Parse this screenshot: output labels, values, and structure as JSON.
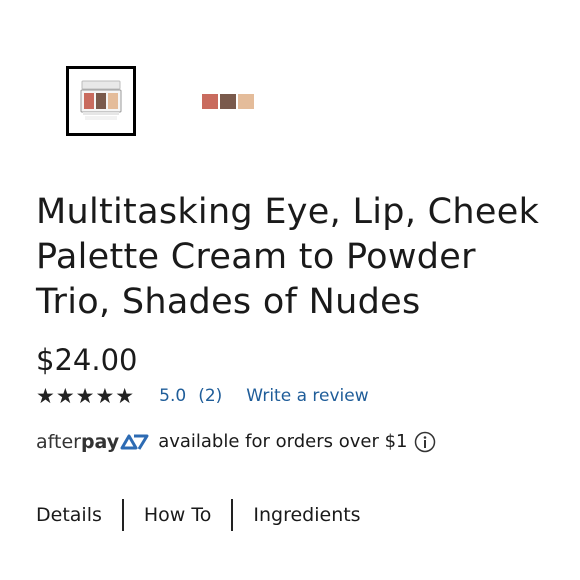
{
  "thumbnails": [
    {
      "name": "palette-open-image",
      "selected": true
    },
    {
      "name": "swatches-image",
      "selected": false
    }
  ],
  "colors": {
    "swatch1": "#c96b5e",
    "swatch2": "#7a5a4c",
    "swatch3": "#e4bc9a",
    "link": "#1f5d99",
    "afterpay_arrow": "#2d6bb3"
  },
  "product": {
    "title": "Multitasking Eye, Lip, Cheek Palette Cream to Powder Trio, Shades of Nudes",
    "price": "$24.00"
  },
  "rating": {
    "stars": "★★★★★",
    "value": "5.0",
    "count": "(2)",
    "write_review": "Write a review"
  },
  "afterpay": {
    "logo_after": "after",
    "logo_pay": "pay",
    "text": "available for orders over $1",
    "info_icon": "info-icon"
  },
  "tabs": [
    {
      "label": "Details"
    },
    {
      "label": "How To"
    },
    {
      "label": "Ingredients"
    }
  ]
}
